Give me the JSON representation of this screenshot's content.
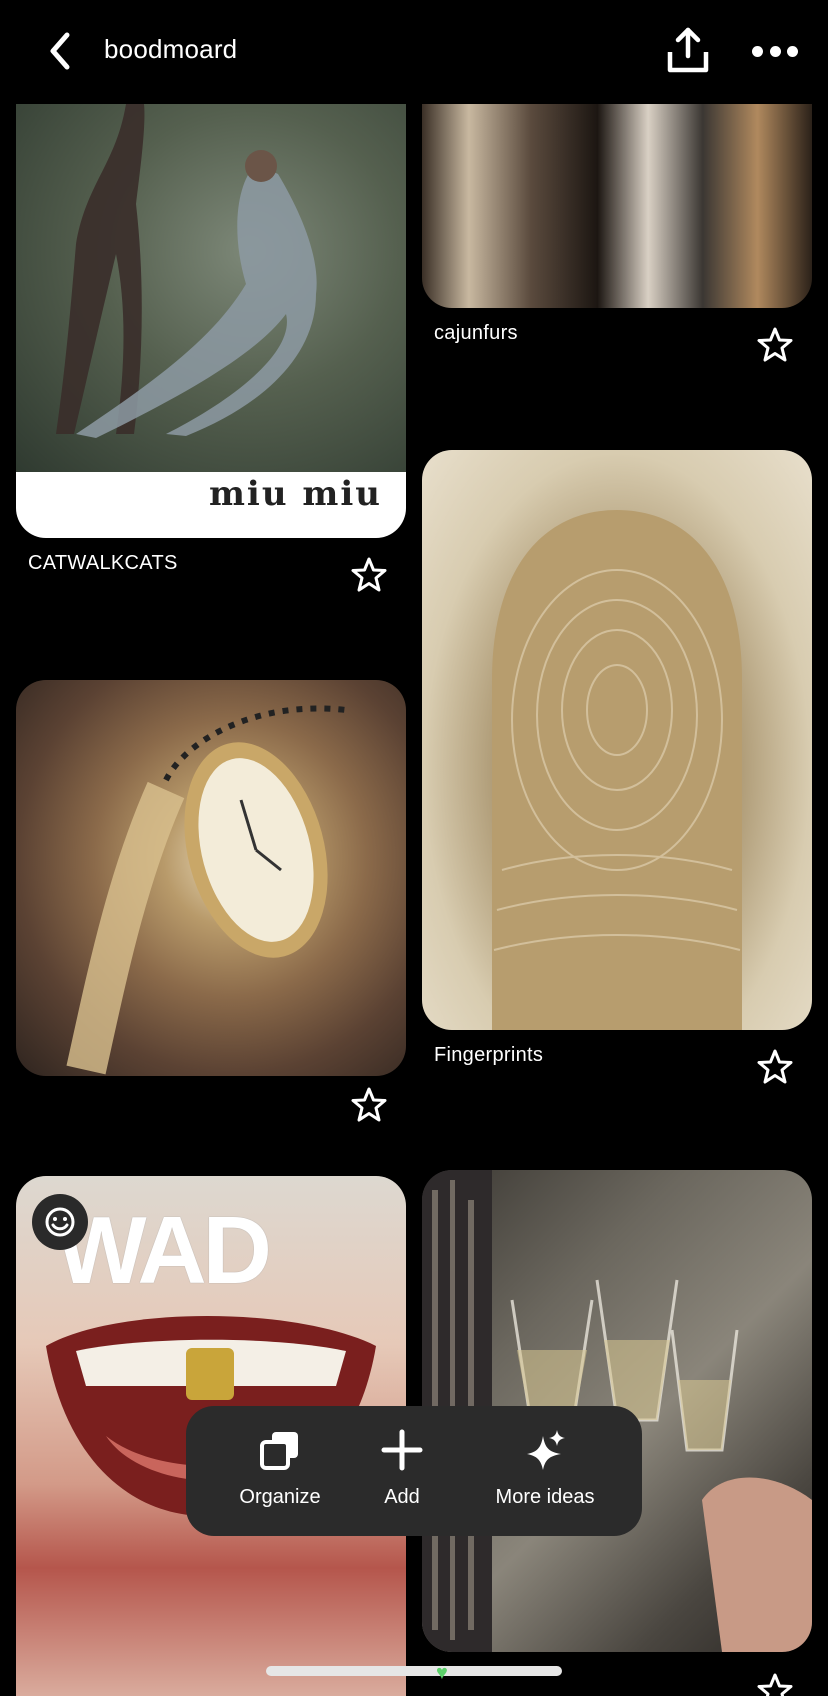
{
  "header": {
    "back_icon": "chevron-left-icon",
    "title": "boodmoard",
    "share_icon": "share-upload-icon",
    "more_icon": "ellipsis-icon"
  },
  "pins": [
    {
      "id": "catwalk",
      "board": "CATWALKCATS",
      "logo_text": "miu miu"
    },
    {
      "id": "furs",
      "board": "cajunfurs"
    },
    {
      "id": "watch",
      "board": ""
    },
    {
      "id": "finger",
      "board": "Fingerprints"
    },
    {
      "id": "wad",
      "board": "",
      "magazine_title": "WAD"
    },
    {
      "id": "champ",
      "board": ""
    }
  ],
  "action_bar": {
    "organize_label": "Organize",
    "add_label": "Add",
    "more_ideas_label": "More ideas"
  },
  "colors": {
    "background": "#000000",
    "action_bar": "#2b2b2b",
    "text": "#ffffff"
  }
}
